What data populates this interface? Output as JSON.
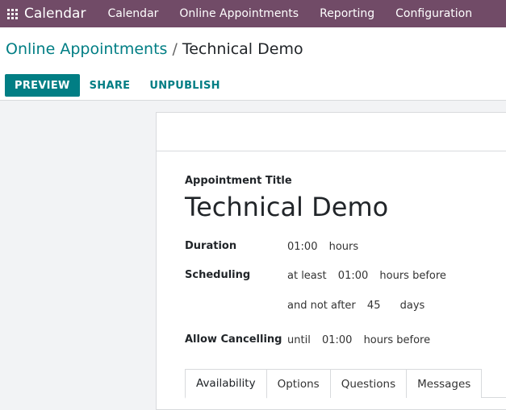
{
  "navbar": {
    "brand": "Calendar",
    "menu": [
      "Calendar",
      "Online Appointments",
      "Reporting",
      "Configuration"
    ]
  },
  "breadcrumb": {
    "parent": "Online Appointments",
    "separator": "/",
    "current": "Technical Demo"
  },
  "actions": {
    "preview": "PREVIEW",
    "share": "SHARE",
    "unpublish": "UNPUBLISH"
  },
  "form": {
    "title_label": "Appointment Title",
    "title_value": "Technical Demo",
    "duration": {
      "label": "Duration",
      "value": "01:00",
      "unit": "hours"
    },
    "scheduling": {
      "label": "Scheduling",
      "prefix": "at least",
      "value": "01:00",
      "unit": "hours before",
      "max_prefix": "and not after",
      "max_value": "45",
      "max_unit": "days"
    },
    "cancelling": {
      "label": "Allow Cancelling",
      "prefix": "until",
      "value": "01:00",
      "unit": "hours before"
    },
    "tabs": [
      "Availability",
      "Options",
      "Questions",
      "Messages"
    ],
    "active_tab": "Availability"
  },
  "colors": {
    "navbar": "#714b67",
    "accent": "#017e84"
  }
}
